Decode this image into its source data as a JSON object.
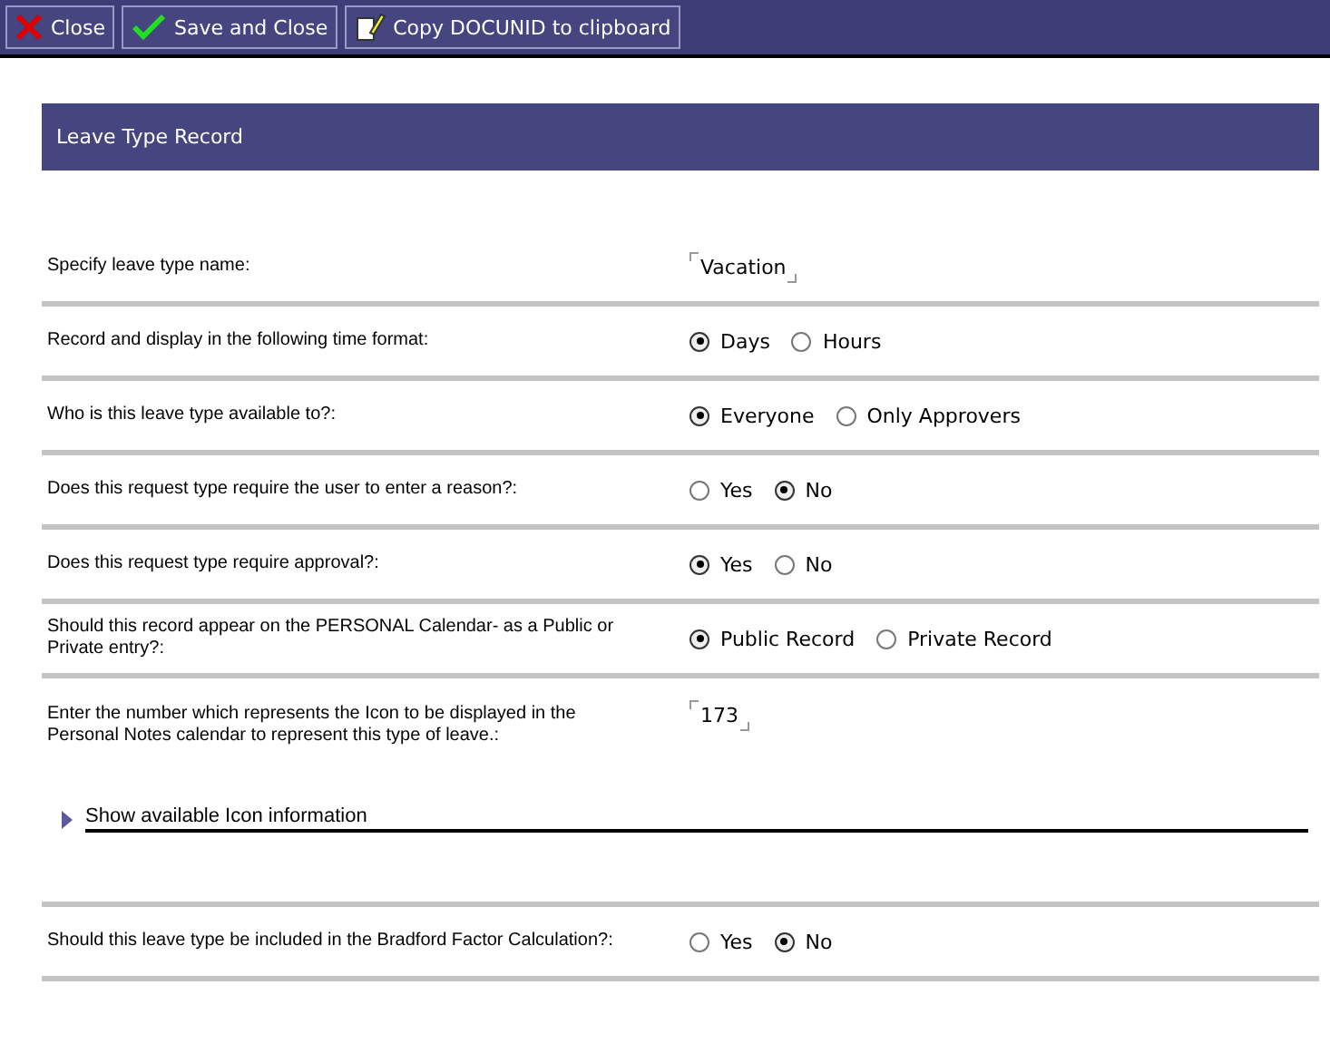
{
  "toolbar": [
    {
      "label": "Close"
    },
    {
      "label": "Save and Close"
    },
    {
      "label": "Copy DOCUNID to clipboard"
    }
  ],
  "header": {
    "title": "Leave Type Record"
  },
  "rows": [
    {
      "kind": "text",
      "label": "Specify leave type name:",
      "value": "Vacation"
    },
    {
      "kind": "radio",
      "label": "Record and display in the following time format:",
      "options": [
        {
          "label": "Days",
          "selected": true
        },
        {
          "label": "Hours",
          "selected": false
        }
      ]
    },
    {
      "kind": "radio",
      "label": "Who is this leave type available to?:",
      "options": [
        {
          "label": "Everyone",
          "selected": true
        },
        {
          "label": "Only Approvers",
          "selected": false
        }
      ]
    },
    {
      "kind": "radio",
      "label": "Does this request type require the user to enter a reason?:",
      "options": [
        {
          "label": "Yes",
          "selected": false
        },
        {
          "label": "No",
          "selected": true
        }
      ]
    },
    {
      "kind": "radio",
      "label": "Does this request type require approval?:",
      "options": [
        {
          "label": "Yes",
          "selected": true
        },
        {
          "label": "No",
          "selected": false
        }
      ]
    },
    {
      "kind": "radio",
      "label": "Should this record appear on the PERSONAL Calendar- as a Public or Private entry?:",
      "options": [
        {
          "label": "Public Record",
          "selected": true
        },
        {
          "label": "Private Record",
          "selected": false
        }
      ]
    },
    {
      "kind": "text",
      "label": "Enter the number which represents the Icon to be displayed in the Personal Notes calendar to represent this type of leave.:",
      "value": "173",
      "expander": {
        "label": "Show available Icon information",
        "expanded": false
      }
    },
    {
      "kind": "radio",
      "label": "Should this leave type be included in the Bradford Factor Calculation?:",
      "options": [
        {
          "label": "Yes",
          "selected": false
        },
        {
          "label": "No",
          "selected": true
        }
      ]
    }
  ]
}
